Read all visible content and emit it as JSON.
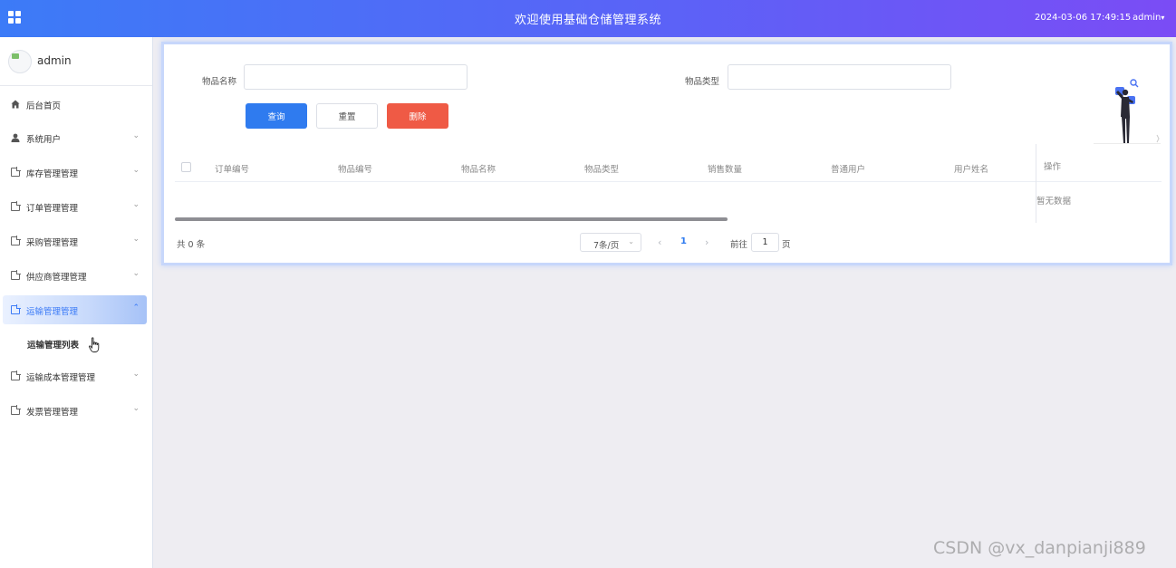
{
  "header": {
    "title": "欢迎使用基础仓储管理系统",
    "datetime": "2024-03-06 17:49:15",
    "user": "admin",
    "user_caret": "▾"
  },
  "sidebar": {
    "username": "admin",
    "items": [
      {
        "label": "后台首页",
        "icon": "home-icon"
      },
      {
        "label": "系统用户",
        "icon": "user-icon",
        "chevron": "⌄"
      },
      {
        "label": "库存管理管理",
        "icon": "doc-icon",
        "chevron": "⌄"
      },
      {
        "label": "订单管理管理",
        "icon": "doc-icon",
        "chevron": "⌄"
      },
      {
        "label": "采购管理管理",
        "icon": "doc-icon",
        "chevron": "⌄"
      },
      {
        "label": "供应商管理管理",
        "icon": "doc-icon",
        "chevron": "⌄"
      },
      {
        "label": "运输管理管理",
        "icon": "doc-icon",
        "chevron": "⌃",
        "active": true
      },
      {
        "label": "运输成本管理管理",
        "icon": "doc-icon",
        "chevron": "⌄"
      },
      {
        "label": "发票管理管理",
        "icon": "doc-icon",
        "chevron": "⌄"
      }
    ],
    "submenu": {
      "label": "运输管理列表"
    }
  },
  "search": {
    "name_label": "物品名称",
    "name_value": "",
    "type_label": "物品类型",
    "type_value": ""
  },
  "buttons": {
    "query": "查询",
    "reset": "重置",
    "delete": "删除"
  },
  "table": {
    "columns": [
      "订单编号",
      "物品编号",
      "物品名称",
      "物品类型",
      "销售数量",
      "普通用户",
      "用户姓名"
    ],
    "action_column": "操作",
    "empty_text": "暂无数据",
    "rows": []
  },
  "pagination": {
    "total": "共 0 条",
    "page_size": "7条/页",
    "prev": "‹",
    "current": "1",
    "next": "›",
    "goto_prefix": "前往",
    "goto_value": "1",
    "goto_suffix": "页"
  },
  "watermark": "CSDN @vx_danpianji889",
  "colors": {
    "accent": "#2f7bef",
    "danger": "#ef5a45",
    "header_start": "#3c7bf7",
    "header_end": "#7b4cf5"
  }
}
